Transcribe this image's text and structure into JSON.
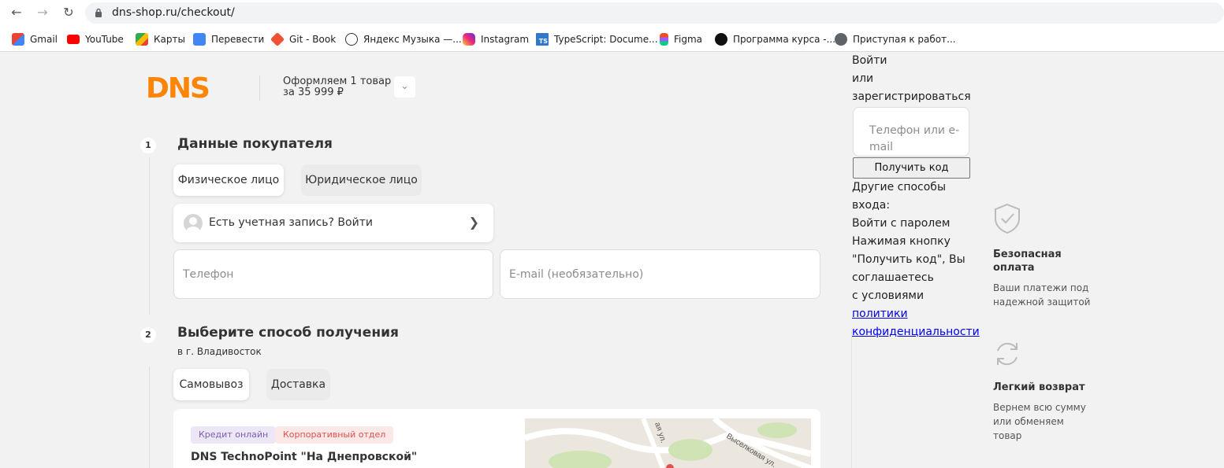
{
  "browser": {
    "url": "dns-shop.ru/checkout/",
    "bookmarks": [
      {
        "label": "Gmail",
        "icon": "gmail-icon"
      },
      {
        "label": "YouTube",
        "icon": "youtube-icon"
      },
      {
        "label": "Карты",
        "icon": "maps-icon"
      },
      {
        "label": "Перевести",
        "icon": "translate-icon"
      },
      {
        "label": "Git - Book",
        "icon": "git-icon"
      },
      {
        "label": "Яндекс Музыка —...",
        "icon": "yandex-music-icon"
      },
      {
        "label": "Instagram",
        "icon": "instagram-icon"
      },
      {
        "label": "TypeScript: Docume...",
        "icon": "typescript-icon"
      },
      {
        "label": "Figma",
        "icon": "figma-icon"
      },
      {
        "label": "Программа курса -...",
        "icon": "course-icon"
      },
      {
        "label": "Приступая к работ...",
        "icon": "globe-icon"
      }
    ]
  },
  "header": {
    "logo": "DNS",
    "order_line1": "Оформляем 1 товар",
    "order_line2": "за 35 999 ₽"
  },
  "step1": {
    "number": "1",
    "title": "Данные покупателя",
    "tab_individual": "Физическое лицо",
    "tab_legal": "Юридическое лицо",
    "login_prompt": "Есть учетная запись? Войти",
    "phone_placeholder": "Телефон",
    "email_placeholder": "E-mail (необязательно)"
  },
  "step2": {
    "number": "2",
    "title": "Выберите способ получения",
    "city": "в г. Владивосток",
    "tab_pickup": "Самовывоз",
    "tab_delivery": "Доставка",
    "tag_credit": "Кредит онлайн",
    "tag_corporate": "Корпоративный отдел",
    "store_name": "DNS TechnoPoint \"На Днепровской\"",
    "map_street1": "Выселковая ул.",
    "map_street2": "ая ул."
  },
  "auth": {
    "line1": "Войти",
    "line2": "или",
    "line3": "зарегистрироваться",
    "input_placeholder": "Телефон или e-mail",
    "button": "Получить код",
    "other1": "Другие способы",
    "other2": "входа:",
    "password_login": "Войти с паролем",
    "consent1": "Нажимая кнопку",
    "consent2": "\"Получить код\", Вы",
    "consent3": "соглашаетесь",
    "consent4": "с условиями",
    "policy_link1": "политики",
    "policy_link2": "конфиденциальности"
  },
  "features": [
    {
      "icon": "shield-check-icon",
      "title1": "Безопасная",
      "title2": "оплата",
      "text1": "Ваши платежи под",
      "text2": "надежной защитой",
      "text3": ""
    },
    {
      "icon": "refresh-icon",
      "title1": "Легкий возврат",
      "title2": "",
      "text1": "Вернем всю сумму",
      "text2": "или обменяем",
      "text3": "товар"
    }
  ],
  "colors": {
    "brand": "#fc8507",
    "tag_credit_bg": "#ece6f7",
    "tag_credit_fg": "#7b5fb0",
    "tag_corporate_bg": "#fde8e8",
    "tag_corporate_fg": "#e05050",
    "link": "#0000ee"
  }
}
